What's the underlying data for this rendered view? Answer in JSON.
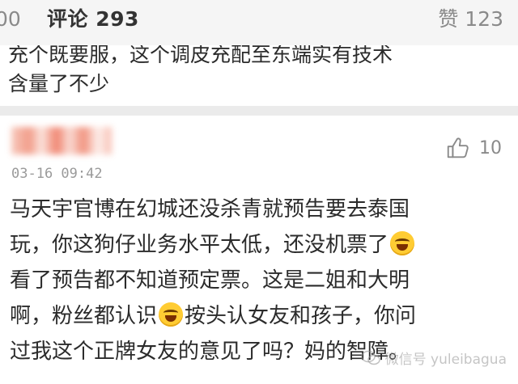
{
  "tabs": {
    "reposts_fragment": "00",
    "comments_label": "评论 293",
    "likes_label": "赞 123"
  },
  "previous_comment": {
    "cut_line": "充个既要服，这个调皮充配至东端实有技术",
    "last_line": "含量了不少"
  },
  "comment": {
    "like_count": "10",
    "timestamp": "03-16 09:42",
    "lines": {
      "l1": "马天宇官博在幻城还没杀青就预告要去泰国",
      "l2": "玩，你这狗仔业务水平太低，还没机票了",
      "l3": "看了预告都不知道预定票。这是二姐和大明",
      "l4a": "啊，粉丝都认识",
      "l4b": "按头认女友和孩子，你问",
      "l5": "过我这个正牌女友的意见了吗？妈的智障。"
    },
    "emoji_name": "laugh-cry-emoji"
  },
  "watermark": {
    "text": "微信号 yuleibagua"
  },
  "colors": {
    "background": "#f5f5f5",
    "text": "#2b2b2b",
    "muted": "#8a8a8a"
  }
}
